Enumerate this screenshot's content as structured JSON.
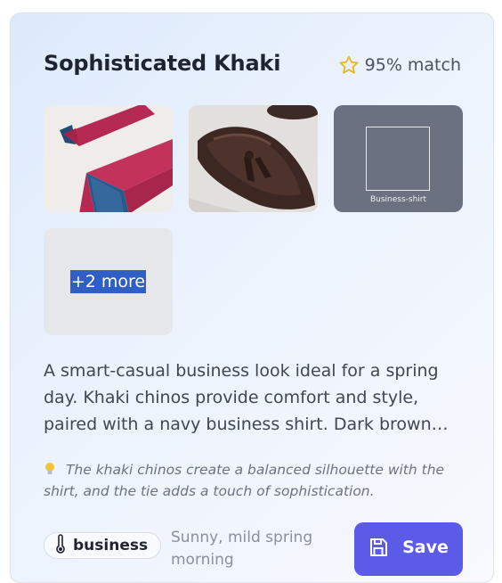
{
  "outfit": {
    "title": "Sophisticated Khaki",
    "match_label": "95% match",
    "items": [
      {
        "icon": "necktie-photo"
      },
      {
        "icon": "loafer-shoe-photo"
      },
      {
        "icon": "image-placeholder-icon",
        "label": "Business-shirt"
      }
    ],
    "more_label": "+2 more",
    "description": "A smart-casual business look ideal for a spring day. Khaki chinos provide comfort and style, paired with a navy business shirt. Dark brown…",
    "tip": "The khaki chinos create a balanced silhouette with the shirt, and the tie adds a touch of sophistication.",
    "occasion_tag": "business",
    "weather": "Sunny, mild spring morning",
    "save_label": "Save"
  },
  "colors": {
    "accent": "#5b5be8",
    "star": "#e8b820",
    "placeholder_bg": "#6b7180"
  }
}
